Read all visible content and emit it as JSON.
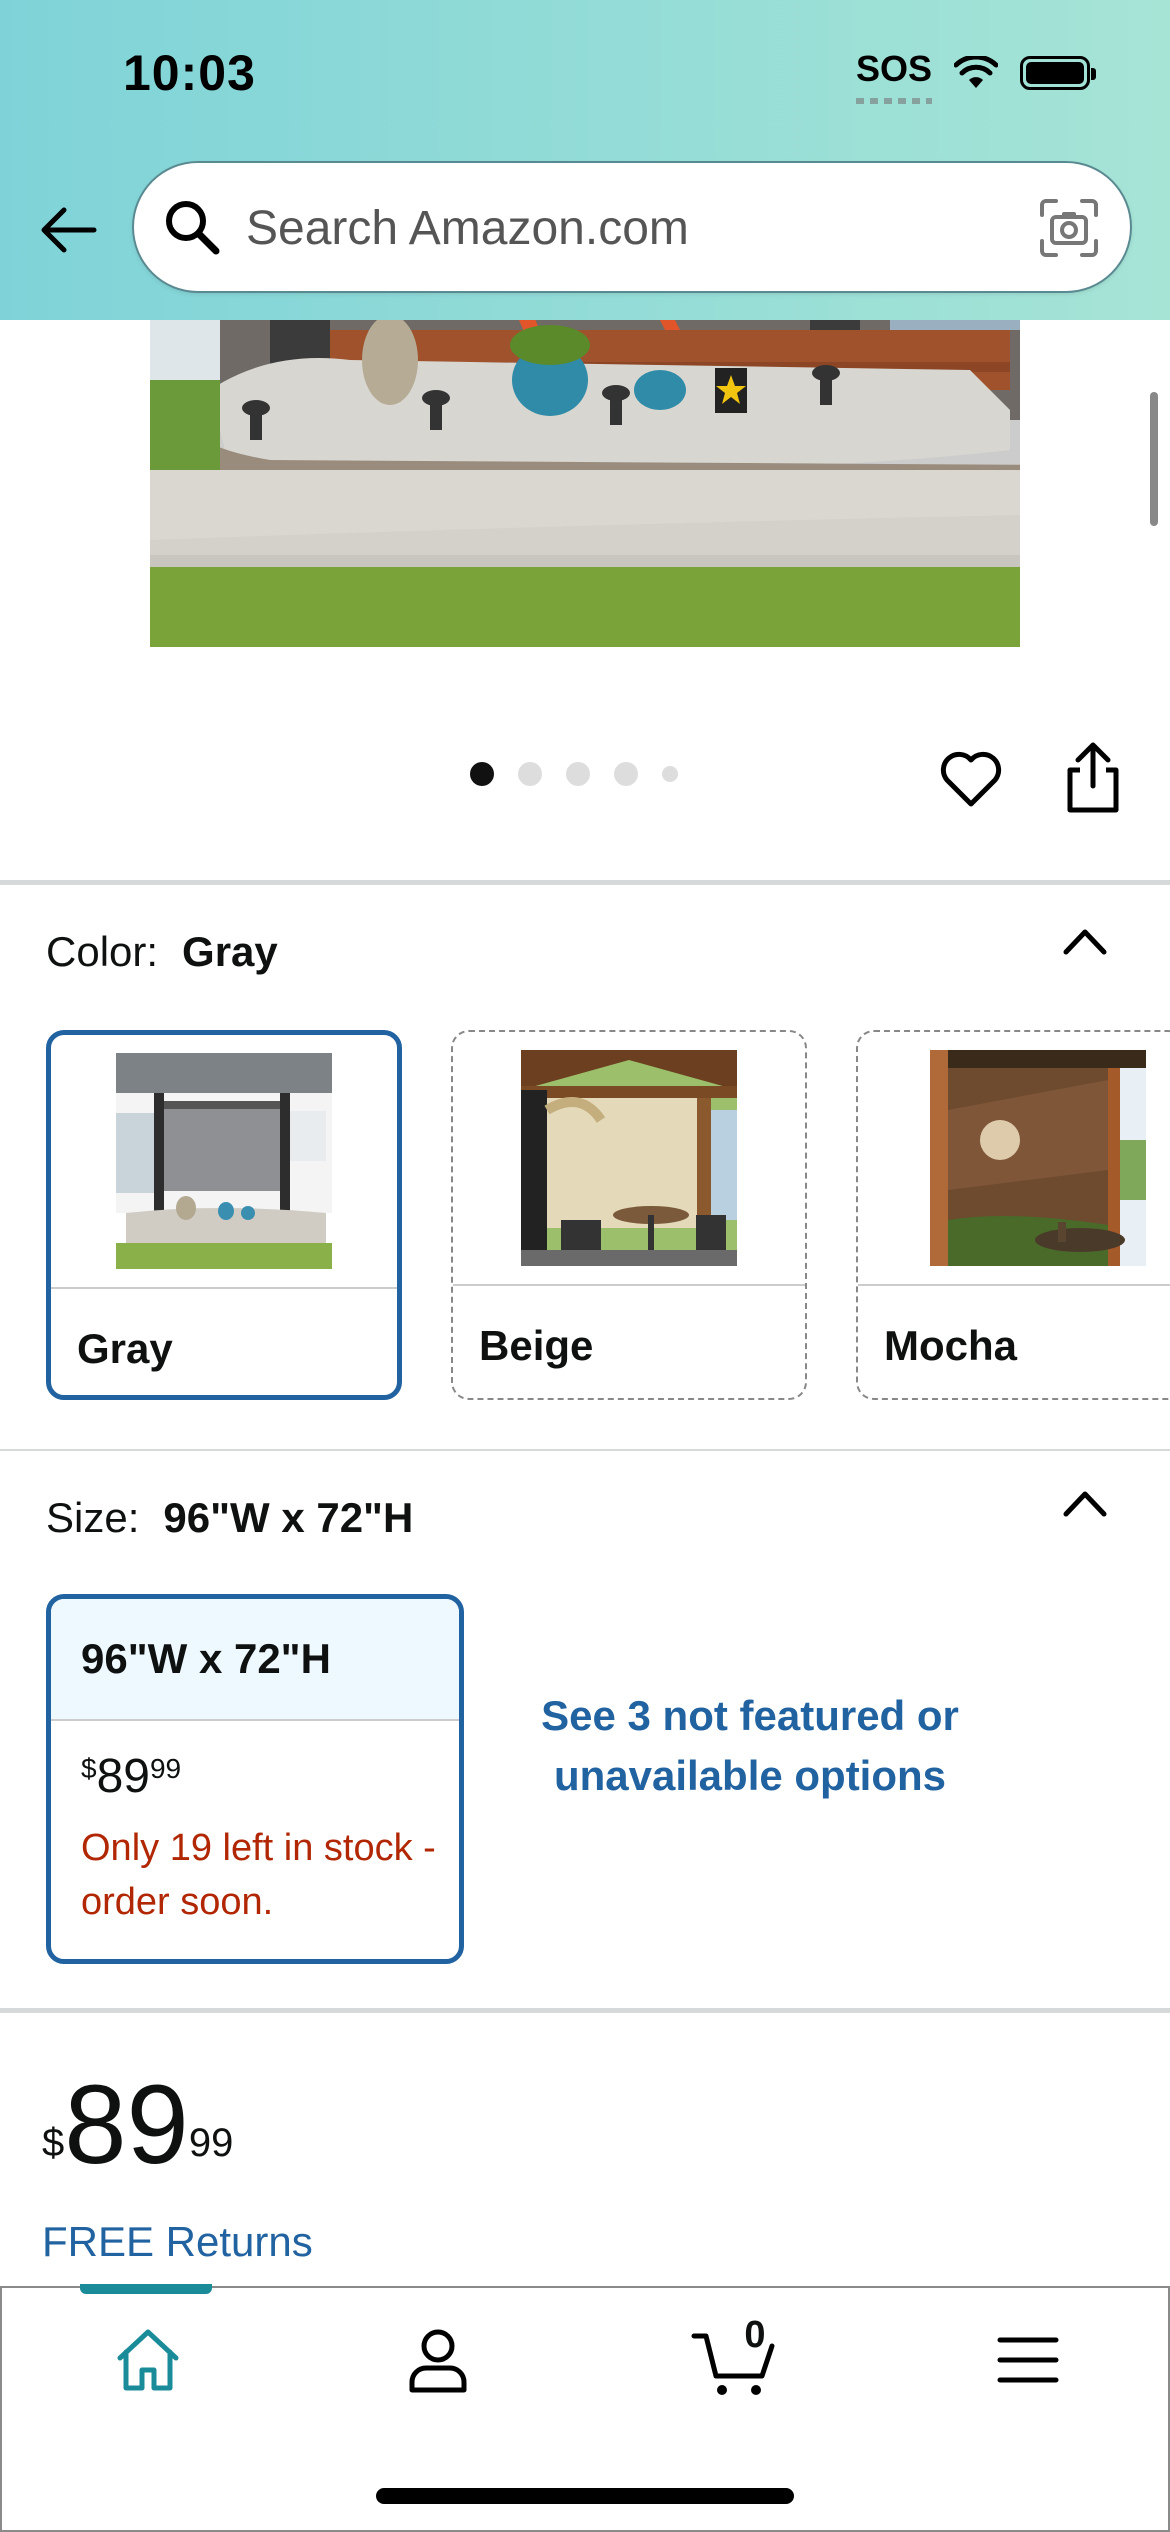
{
  "status_bar": {
    "time": "10:03",
    "sos": "SOS"
  },
  "search": {
    "placeholder": "Search Amazon.com"
  },
  "image_carousel": {
    "count": 5,
    "active_index": 0
  },
  "color": {
    "label": "Color:",
    "selected": "Gray",
    "options": [
      {
        "name": "Gray",
        "selected": true,
        "available": true
      },
      {
        "name": "Beige",
        "selected": false,
        "available": false
      },
      {
        "name": "Mocha",
        "selected": false,
        "available": false
      }
    ]
  },
  "size": {
    "label": "Size:",
    "selected": "96\"W x 72\"H",
    "card": {
      "title": "96\"W x 72\"H",
      "price_symbol": "$",
      "price_dollars": "89",
      "price_cents": "99",
      "stock": "Only 19 left in stock - order soon."
    },
    "see_more": "See 3 not featured or unavailable options"
  },
  "price": {
    "symbol": "$",
    "dollars": "89",
    "cents": "99"
  },
  "free_returns": "FREE Returns",
  "bottom_nav": {
    "cart_count": "0",
    "active": "home"
  },
  "colors": {
    "link": "#2162a1",
    "selected_border": "#2162a1",
    "stock_red": "#b12704",
    "nav_active": "#1a8c99"
  }
}
